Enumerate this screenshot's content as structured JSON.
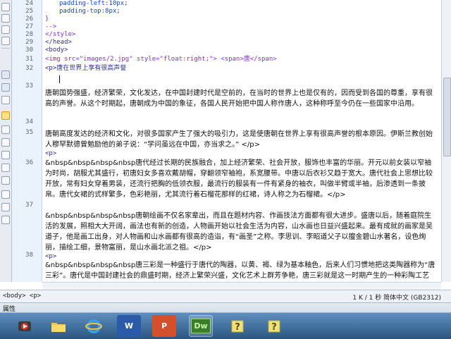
{
  "editor": {
    "line_numbers": [
      "24",
      "25",
      "26",
      "27",
      "28",
      "29",
      "30",
      "31",
      "32",
      "33",
      "34",
      "35",
      "36",
      "37",
      "38"
    ],
    "lines": {
      "l24": "padding-left:10px;",
      "l25": "padding-top:8px;",
      "l26": "}",
      "l27": "-->",
      "l28": "</style>",
      "l29": "</head>",
      "l30": "<body>",
      "l31": "<img src=\"images/2.jpg\" style=\"float:right;\"> <span>唐</span>",
      "l32": "<p>唐在世界上享有很高声誉",
      "p33": "唐朝国势强盛，经济繁荣，文化发达，在中国封建时代是空前的，在当时的世界上也是仅有的，因而受到各国的尊重，享有很高的声誉。从这个时期起，唐朝成为中国的象征，各国人民开始把中国人称作唐人，这种称呼至今仍在一些国家中沿用。",
      "p35a": "唐朝高度发达的经济和文化，对很多国家产生了强大的吸引力，这是使唐朝在世界上享有很高声誉的根本原因。伊斯兰教创始人穆罕默德曾勉励他的弟子说：“学问虽远在中国，亦当求之。” </p>",
      "p35b": "<p>",
      "p36": "&nbsp&nbsp&nbsp&nbsp唐代经过长期的民族融合，加上经济繁荣、社会开放，服饰也丰富的华丽。开元以前女装以窄袖为时尚，胡服尤其盛行，初唐妇女多喜欢戴胡帽，穿翻领窄袖袍，系宽腰带。中唐以后衣衫又趋于宽大。唐代社会上思想比较开放，常有妇女穿着男装，还流行把胸的低领衣服，最流行的服装有一件有紧身的袖衣，叫做半臂或半袖，后渗透到一条披帛。唐代女裙的式样繁多，色彩艳丽，尤其流行着石榴花那样的红裙，诗人称之为石榴裙。</p>",
      "p36b": "<p>",
      "p37": "&nbsp&nbsp&nbsp&nbsp唐朝绘画不仅名家辈出，而且在题材内容、作画技法方面都有很大进步。盛唐以后，随着庭院生活的发展，照相大大开阔，画法也有新的创造，人物画开始以社会生活为内容，山水画也日益兴盛起来。最有成就的画家是吴道子，他是画工出身，对人物画和山水画都有很高的造诣，有“画圣”之称。李思训、李昭道父子以擅金碧山水著名，设色绚丽，描绘工细，景物富丽，是山水画北派之祖。</p>",
      "p38a": "<p>",
      "p38": "&nbsp&nbsp&nbsp&nbsp唐三彩是一种盛行于唐代的陶器，以黄、褐、绿为基本釉色，后来人们习惯地把这类陶器称为“唐三彩”。唐代是中国封建社会的鼎盛时期，经济上繁荣兴盛，文化艺术上群芳争艳，唐三彩就是这一时期产生的一种彩陶工艺品，它以造型生动逼真，色泽艳丽和富有生活气息而著称，唐三彩"
    }
  },
  "statusbar": {
    "tag_selector": "<body> <p>",
    "info": "1 K / 1 秒  简体中文 (GB2312)"
  },
  "properties_panel": {
    "title": "属性"
  },
  "taskbar": {
    "apps": [
      "media",
      "explorer",
      "ie",
      "word",
      "powerpoint",
      "dreamweaver",
      "help",
      "help"
    ],
    "dw_label": "Dw",
    "word_label": "W",
    "ppt_label": "P"
  },
  "colors": {
    "tag_purple": "#8a2be2",
    "tag_navy": "#2d2d9a",
    "text_blue": "#1c43c9",
    "gutter_bg": "#eaf2fb",
    "taskbar_blue": "#2a5580"
  }
}
